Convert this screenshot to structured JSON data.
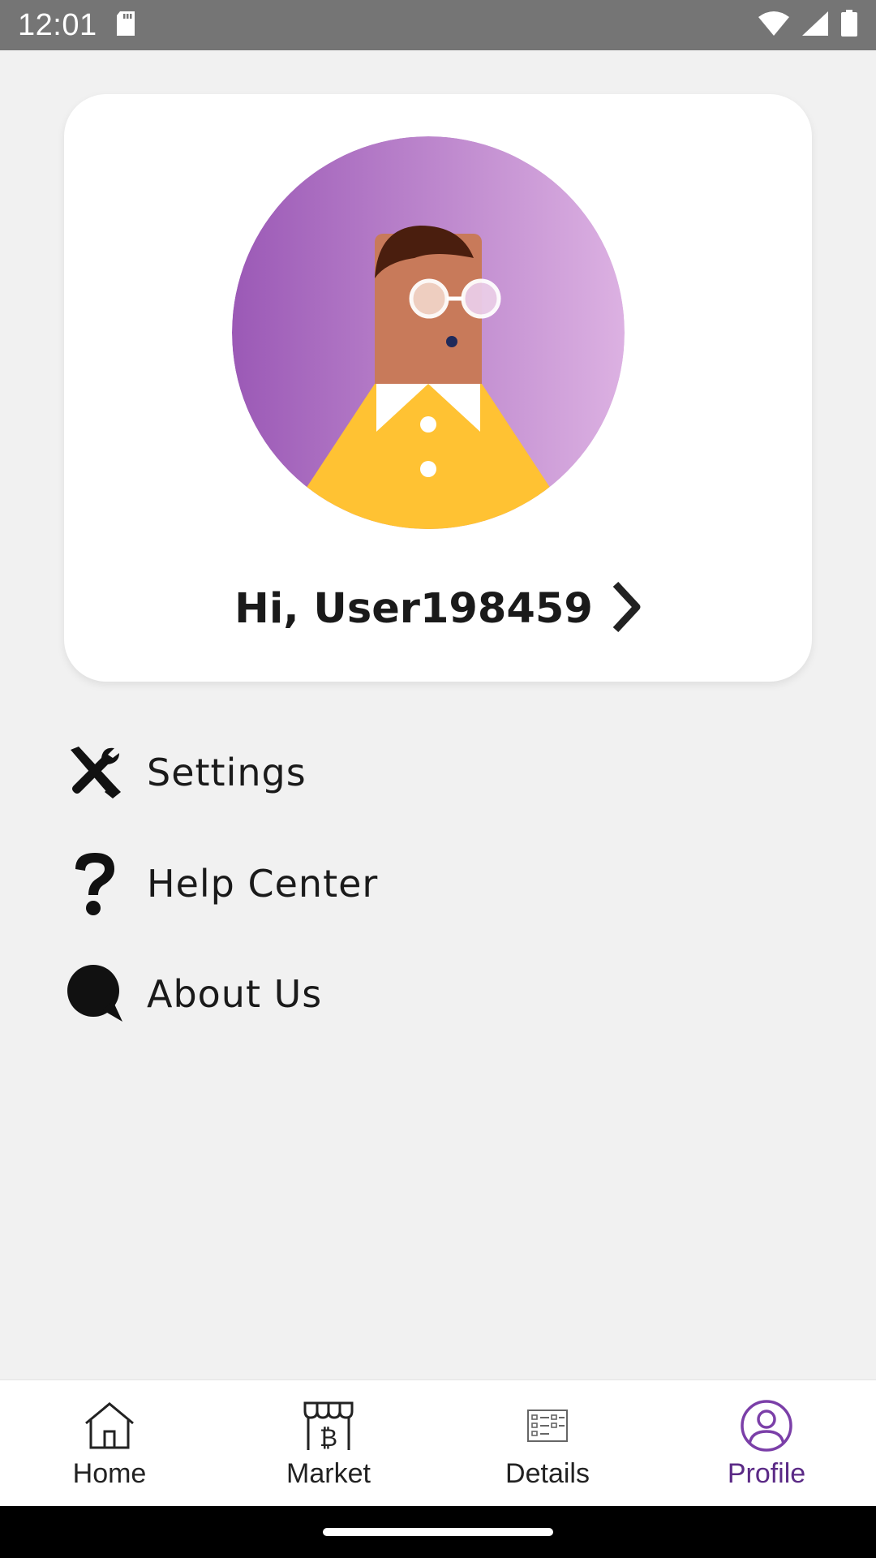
{
  "status_bar": {
    "time": "12:01",
    "icons": [
      "sd-card-icon",
      "wifi-icon",
      "cell-signal-icon",
      "battery-icon"
    ]
  },
  "profile": {
    "greeting": "Hi, User198459",
    "avatar": "avatar-illustration",
    "chevron": "chevron-right-icon"
  },
  "menu": [
    {
      "label": "Settings",
      "icon": "settings-tools-icon"
    },
    {
      "label": "Help Center",
      "icon": "question-mark-icon"
    },
    {
      "label": "About Us",
      "icon": "chat-bubble-icon"
    }
  ],
  "bottom_nav": [
    {
      "label": "Home",
      "icon": "home-icon",
      "active": false
    },
    {
      "label": "Market",
      "icon": "market-bitcoin-icon",
      "active": false
    },
    {
      "label": "Details",
      "icon": "details-list-icon",
      "active": false
    },
    {
      "label": "Profile",
      "icon": "profile-user-icon",
      "active": true
    }
  ],
  "colors": {
    "accent": "#5b2a86",
    "background": "#f1f1f1",
    "avatar_gradient": [
      "#9b59b6",
      "#dcb1e2"
    ],
    "shirt": "#ffc233",
    "skin": "#c87a5a"
  }
}
